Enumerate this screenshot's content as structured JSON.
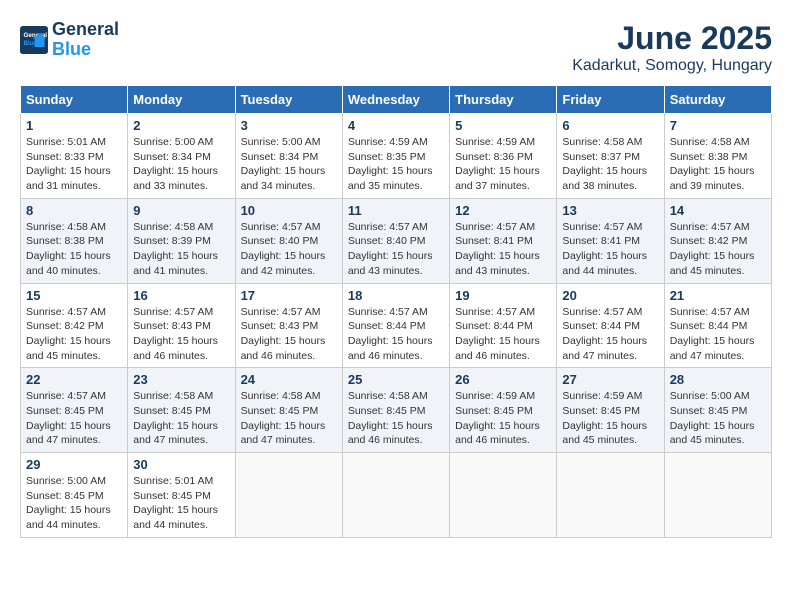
{
  "header": {
    "logo_line1": "General",
    "logo_line2": "Blue",
    "month": "June 2025",
    "location": "Kadarkut, Somogy, Hungary"
  },
  "days_of_week": [
    "Sunday",
    "Monday",
    "Tuesday",
    "Wednesday",
    "Thursday",
    "Friday",
    "Saturday"
  ],
  "weeks": [
    [
      {
        "day": "1",
        "info": "Sunrise: 5:01 AM\nSunset: 8:33 PM\nDaylight: 15 hours\nand 31 minutes."
      },
      {
        "day": "2",
        "info": "Sunrise: 5:00 AM\nSunset: 8:34 PM\nDaylight: 15 hours\nand 33 minutes."
      },
      {
        "day": "3",
        "info": "Sunrise: 5:00 AM\nSunset: 8:34 PM\nDaylight: 15 hours\nand 34 minutes."
      },
      {
        "day": "4",
        "info": "Sunrise: 4:59 AM\nSunset: 8:35 PM\nDaylight: 15 hours\nand 35 minutes."
      },
      {
        "day": "5",
        "info": "Sunrise: 4:59 AM\nSunset: 8:36 PM\nDaylight: 15 hours\nand 37 minutes."
      },
      {
        "day": "6",
        "info": "Sunrise: 4:58 AM\nSunset: 8:37 PM\nDaylight: 15 hours\nand 38 minutes."
      },
      {
        "day": "7",
        "info": "Sunrise: 4:58 AM\nSunset: 8:38 PM\nDaylight: 15 hours\nand 39 minutes."
      }
    ],
    [
      {
        "day": "8",
        "info": "Sunrise: 4:58 AM\nSunset: 8:38 PM\nDaylight: 15 hours\nand 40 minutes."
      },
      {
        "day": "9",
        "info": "Sunrise: 4:58 AM\nSunset: 8:39 PM\nDaylight: 15 hours\nand 41 minutes."
      },
      {
        "day": "10",
        "info": "Sunrise: 4:57 AM\nSunset: 8:40 PM\nDaylight: 15 hours\nand 42 minutes."
      },
      {
        "day": "11",
        "info": "Sunrise: 4:57 AM\nSunset: 8:40 PM\nDaylight: 15 hours\nand 43 minutes."
      },
      {
        "day": "12",
        "info": "Sunrise: 4:57 AM\nSunset: 8:41 PM\nDaylight: 15 hours\nand 43 minutes."
      },
      {
        "day": "13",
        "info": "Sunrise: 4:57 AM\nSunset: 8:41 PM\nDaylight: 15 hours\nand 44 minutes."
      },
      {
        "day": "14",
        "info": "Sunrise: 4:57 AM\nSunset: 8:42 PM\nDaylight: 15 hours\nand 45 minutes."
      }
    ],
    [
      {
        "day": "15",
        "info": "Sunrise: 4:57 AM\nSunset: 8:42 PM\nDaylight: 15 hours\nand 45 minutes."
      },
      {
        "day": "16",
        "info": "Sunrise: 4:57 AM\nSunset: 8:43 PM\nDaylight: 15 hours\nand 46 minutes."
      },
      {
        "day": "17",
        "info": "Sunrise: 4:57 AM\nSunset: 8:43 PM\nDaylight: 15 hours\nand 46 minutes."
      },
      {
        "day": "18",
        "info": "Sunrise: 4:57 AM\nSunset: 8:44 PM\nDaylight: 15 hours\nand 46 minutes."
      },
      {
        "day": "19",
        "info": "Sunrise: 4:57 AM\nSunset: 8:44 PM\nDaylight: 15 hours\nand 46 minutes."
      },
      {
        "day": "20",
        "info": "Sunrise: 4:57 AM\nSunset: 8:44 PM\nDaylight: 15 hours\nand 47 minutes."
      },
      {
        "day": "21",
        "info": "Sunrise: 4:57 AM\nSunset: 8:44 PM\nDaylight: 15 hours\nand 47 minutes."
      }
    ],
    [
      {
        "day": "22",
        "info": "Sunrise: 4:57 AM\nSunset: 8:45 PM\nDaylight: 15 hours\nand 47 minutes."
      },
      {
        "day": "23",
        "info": "Sunrise: 4:58 AM\nSunset: 8:45 PM\nDaylight: 15 hours\nand 47 minutes."
      },
      {
        "day": "24",
        "info": "Sunrise: 4:58 AM\nSunset: 8:45 PM\nDaylight: 15 hours\nand 47 minutes."
      },
      {
        "day": "25",
        "info": "Sunrise: 4:58 AM\nSunset: 8:45 PM\nDaylight: 15 hours\nand 46 minutes."
      },
      {
        "day": "26",
        "info": "Sunrise: 4:59 AM\nSunset: 8:45 PM\nDaylight: 15 hours\nand 46 minutes."
      },
      {
        "day": "27",
        "info": "Sunrise: 4:59 AM\nSunset: 8:45 PM\nDaylight: 15 hours\nand 45 minutes."
      },
      {
        "day": "28",
        "info": "Sunrise: 5:00 AM\nSunset: 8:45 PM\nDaylight: 15 hours\nand 45 minutes."
      }
    ],
    [
      {
        "day": "29",
        "info": "Sunrise: 5:00 AM\nSunset: 8:45 PM\nDaylight: 15 hours\nand 44 minutes."
      },
      {
        "day": "30",
        "info": "Sunrise: 5:01 AM\nSunset: 8:45 PM\nDaylight: 15 hours\nand 44 minutes."
      },
      {
        "day": "",
        "info": ""
      },
      {
        "day": "",
        "info": ""
      },
      {
        "day": "",
        "info": ""
      },
      {
        "day": "",
        "info": ""
      },
      {
        "day": "",
        "info": ""
      }
    ]
  ]
}
